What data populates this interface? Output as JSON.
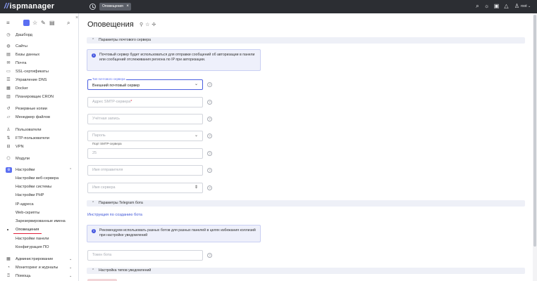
{
  "app": {
    "logo_prefix": "//",
    "logo_text": "ispmanager"
  },
  "tabs": [
    {
      "label": "Оповещения"
    }
  ],
  "topbar": {
    "user_label": "root"
  },
  "sidebar": {
    "items": [
      {
        "label": "Дашборд"
      },
      {
        "label": "Сайты"
      },
      {
        "label": "Базы данных"
      },
      {
        "label": "Почта"
      },
      {
        "label": "SSL-сертификаты"
      },
      {
        "label": "Управление DNS"
      },
      {
        "label": "Docker"
      },
      {
        "label": "Планировщик CRON"
      },
      {
        "label": "Резервные копии"
      },
      {
        "label": "Менеджер файлов"
      },
      {
        "label": "Пользователи"
      },
      {
        "label": "FTP-пользователи"
      },
      {
        "label": "VPN"
      },
      {
        "label": "Модули"
      },
      {
        "label": "Настройки"
      },
      {
        "label": "Настройки веб-сервера"
      },
      {
        "label": "Настройки системы"
      },
      {
        "label": "Настройки PHP"
      },
      {
        "label": "IP-адреса"
      },
      {
        "label": "Web-скрипты"
      },
      {
        "label": "Зарезервированные имена"
      },
      {
        "label": "Оповещения"
      },
      {
        "label": "Настройки панели"
      },
      {
        "label": "Конфигурация ПО"
      },
      {
        "label": "Администрирование"
      },
      {
        "label": "Мониторинг и журналы"
      },
      {
        "label": "Помощь"
      }
    ]
  },
  "main": {
    "title": "Оповещения",
    "mail_section": {
      "title": "Параметры почтового сервера",
      "notice": "Почтовый сервер будет использоваться для отправки сообщений об авторизации в панели или сообщений отслеживания региона по IP при авторизации.",
      "server_type_label": "Тип почтового сервера",
      "server_type_value": "Внешний почтовый сервер",
      "smtp_address_placeholder": "Адрес SMTP-сервера",
      "smtp_address_required": "*",
      "account_placeholder": "Учётная запись",
      "password_placeholder": "Пароль",
      "smtp_port_label": "Порт SMTP-сервера",
      "smtp_port_value": "25",
      "sender_placeholder": "Имя отправителя",
      "server_name_placeholder": "Имя сервера"
    },
    "telegram_section": {
      "title": "Параметры Telegram бота",
      "instruction_link": "Инструкция по созданию бота",
      "notice": "Рекомендуем использовать разных ботов для разных панелей в целях избежания коллизий при настройке уведомлений",
      "token_placeholder": "Токен бота"
    },
    "types_section": {
      "title": "Настройка типов уведомлений"
    }
  }
}
